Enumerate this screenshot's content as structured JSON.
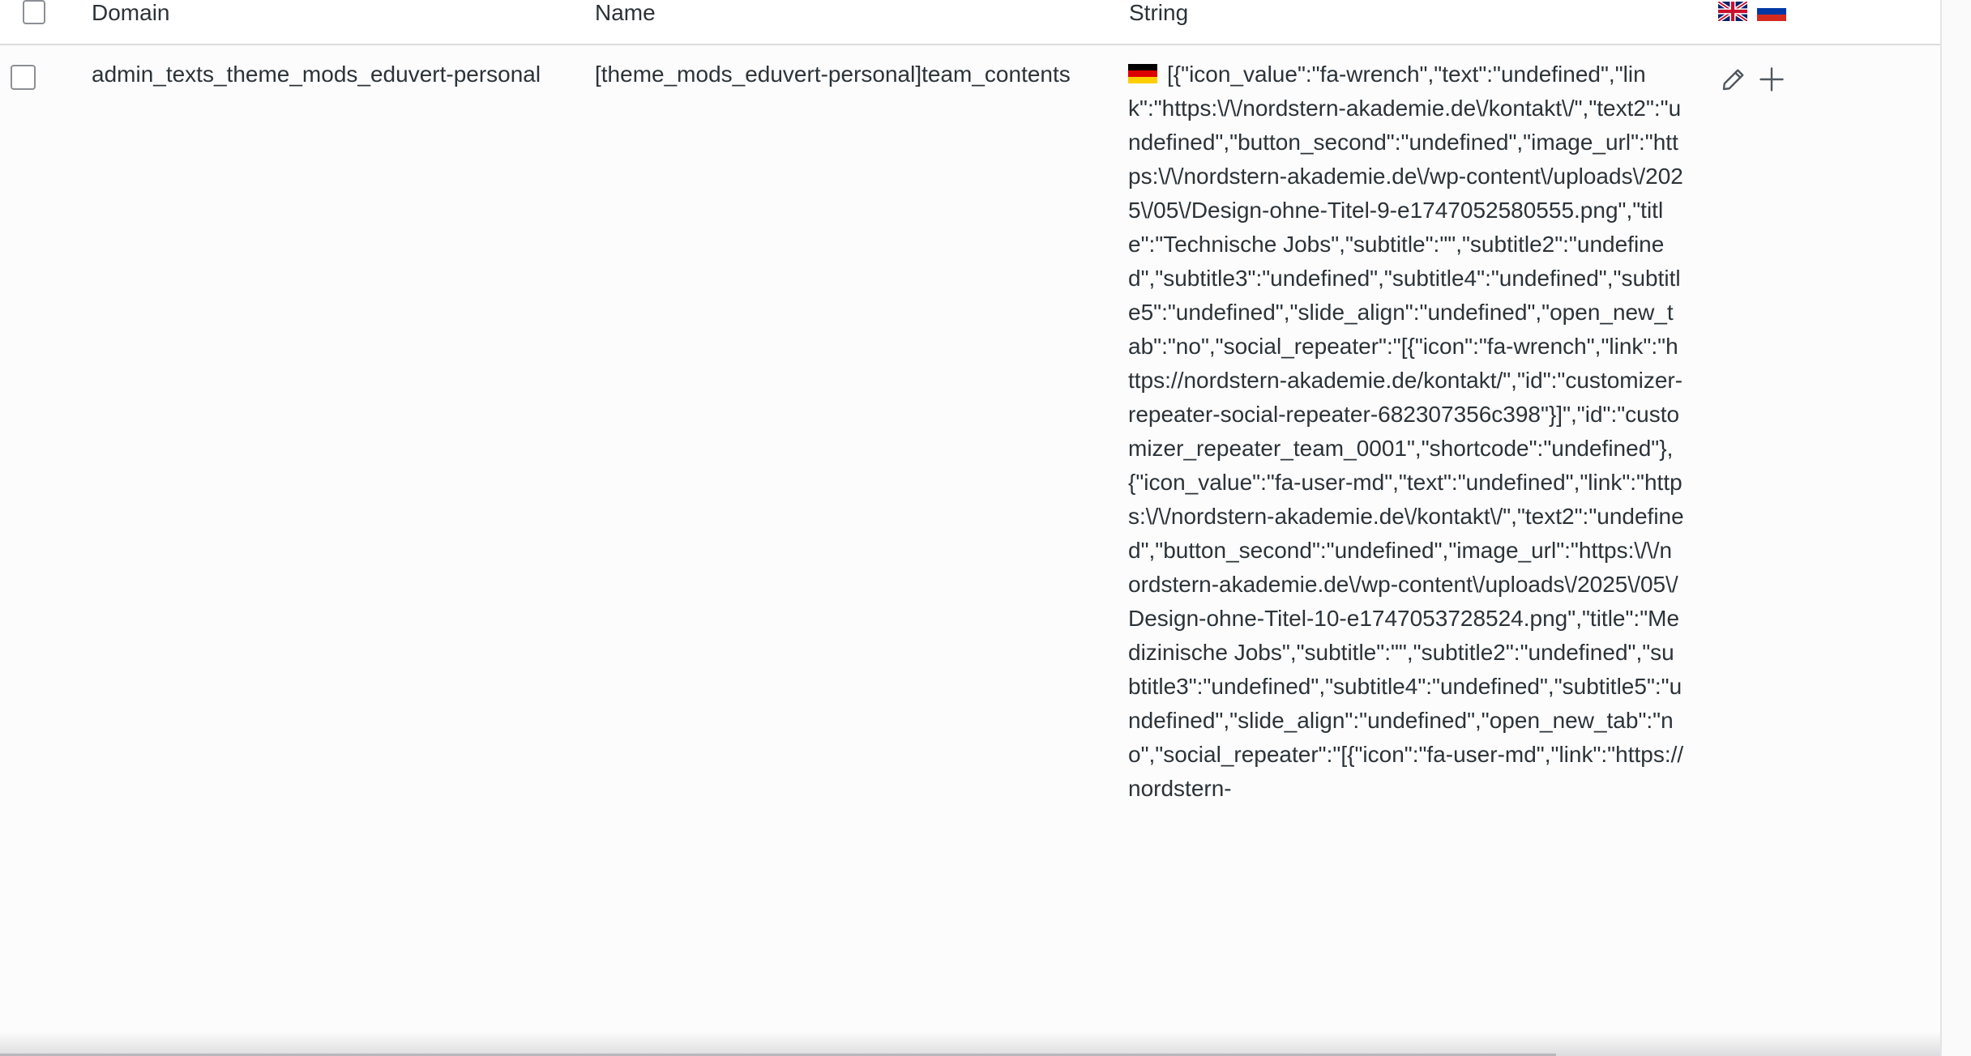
{
  "header": {
    "domain_label": "Domain",
    "name_label": "Name",
    "string_label": "String",
    "language_flags": [
      "flag-en-icon",
      "flag-ru-icon"
    ]
  },
  "row": {
    "domain": "admin_texts_theme_mods_eduvert-personal",
    "name": "[theme_mods_eduvert-personal]team_contents",
    "string_language_flag": "flag-de-icon",
    "string": "[{\"icon_value\":\"fa-wrench\",\"text\":\"undefined\",\"link\":\"https:\\/\\/nordstern-akademie.de\\/kontakt\\/\",\"text2\":\"undefined\",\"button_second\":\"undefined\",\"image_url\":\"https:\\/\\/nordstern-akademie.de\\/wp-content\\/uploads\\/2025\\/05\\/Design-ohne-Titel-9-e1747052580555.png\",\"title\":\"Technische Jobs\",\"subtitle\":\"\",\"subtitle2\":\"undefined\",\"subtitle3\":\"undefined\",\"subtitle4\":\"undefined\",\"subtitle5\":\"undefined\",\"slide_align\":\"undefined\",\"open_new_tab\":\"no\",\"social_repeater\":\"[{\"icon\":\"fa-wrench\",\"link\":\"https://nordstern-akademie.de/kontakt/\",\"id\":\"customizer-repeater-social-repeater-682307356c398\"}]\",\"id\":\"customizer_repeater_team_0001\",\"shortcode\":\"undefined\"},{\"icon_value\":\"fa-user-md\",\"text\":\"undefined\",\"link\":\"https:\\/\\/nordstern-akademie.de\\/kontakt\\/\",\"text2\":\"undefined\",\"button_second\":\"undefined\",\"image_url\":\"https:\\/\\/nordstern-akademie.de\\/wp-content\\/uploads\\/2025\\/05\\/Design-ohne-Titel-10-e1747053728524.png\",\"title\":\"Medizinische Jobs\",\"subtitle\":\"\",\"subtitle2\":\"undefined\",\"subtitle3\":\"undefined\",\"subtitle4\":\"undefined\",\"subtitle5\":\"undefined\",\"slide_align\":\"undefined\",\"open_new_tab\":\"no\",\"social_repeater\":\"[{\"icon\":\"fa-user-md\",\"link\":\"https://nordstern-",
    "actions": [
      "edit-pencil-icon",
      "add-plus-icon"
    ]
  },
  "colors": {
    "text": "#2c3338",
    "border": "#dcdcde",
    "action_icon": "#50575e",
    "checkbox_border": "#8c8f94"
  }
}
